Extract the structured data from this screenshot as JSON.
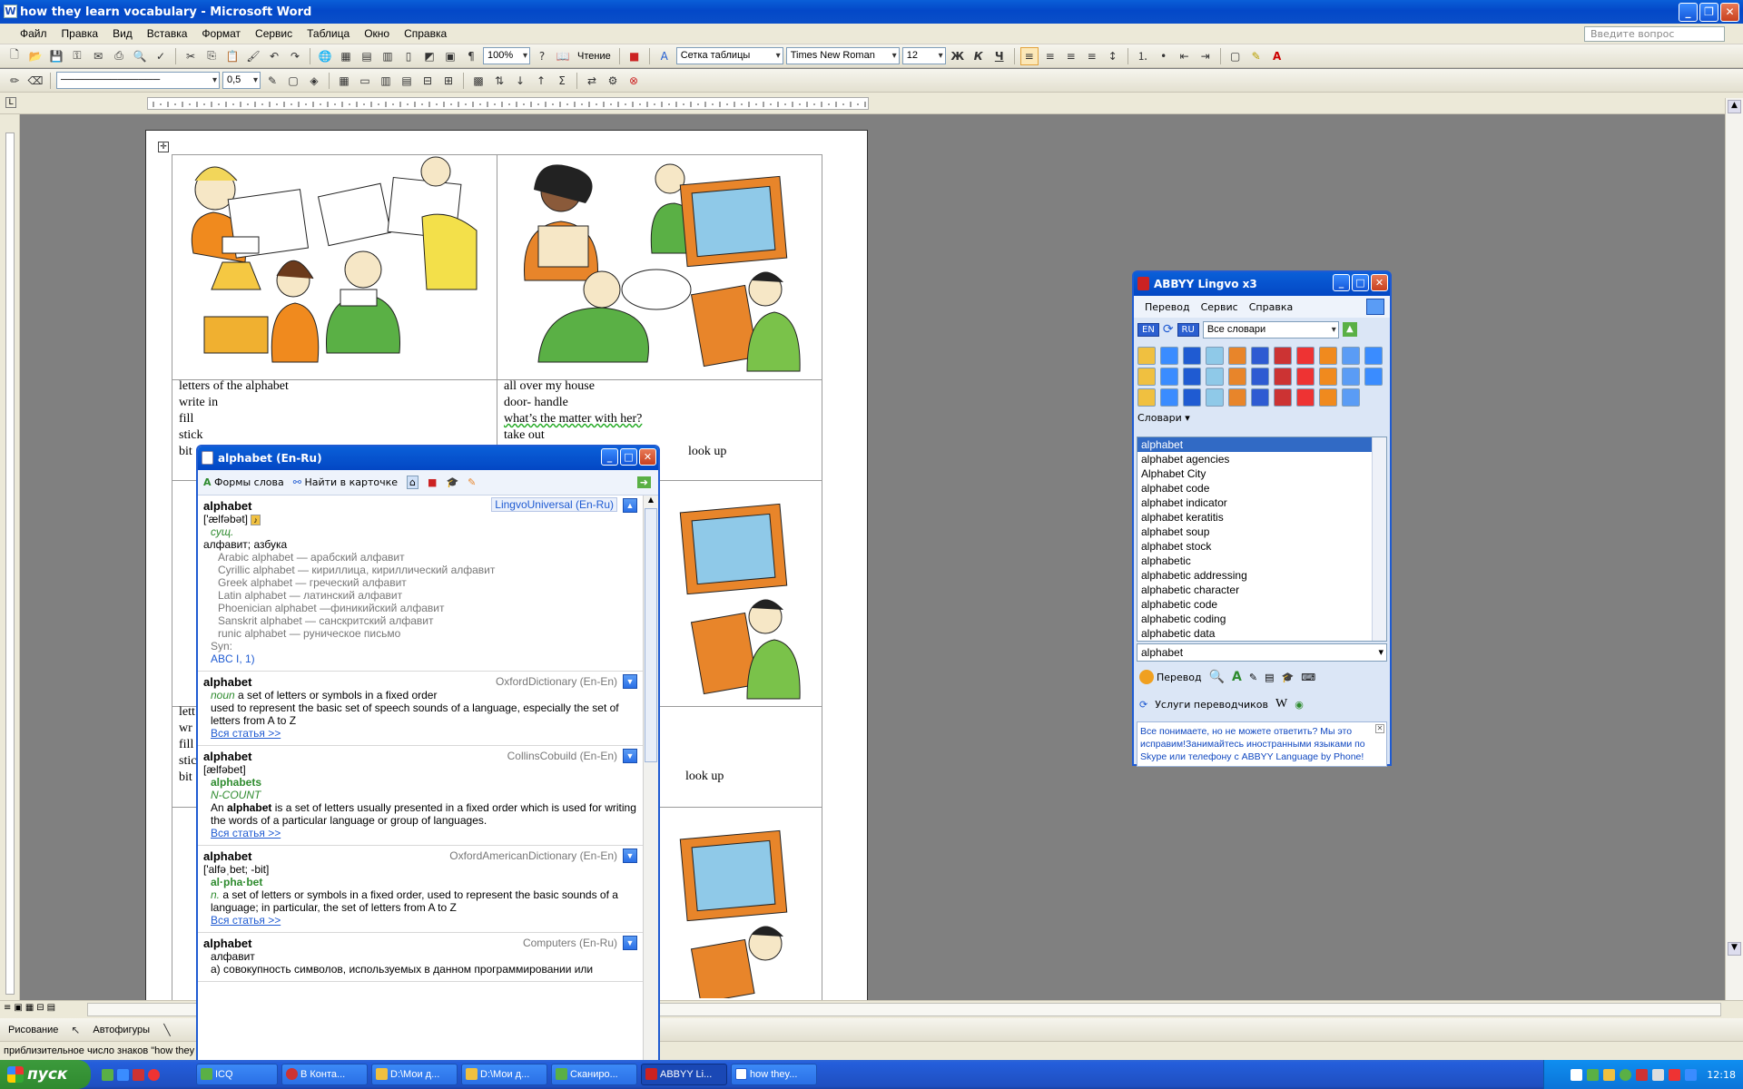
{
  "window": {
    "title": "how they learn vocabulary - Microsoft Word",
    "ask_placeholder": "Введите вопрос"
  },
  "menu": [
    "Файл",
    "Правка",
    "Вид",
    "Вставка",
    "Формат",
    "Сервис",
    "Таблица",
    "Окно",
    "Справка"
  ],
  "toolbar": {
    "zoom": "100%",
    "read_label": "Чтение",
    "table_style": "Сетка таблицы",
    "font": "Times New Roman",
    "size": "12",
    "bold": "Ж",
    "italic": "К",
    "underline": "Ч",
    "line_width": "0,5"
  },
  "document": {
    "cell_left_lines": [
      "letters of the alphabet",
      "write in",
      "fill",
      "stick",
      "bit"
    ],
    "cell_right_lines": [
      "all over my house",
      "door- handle",
      "what’s the matter with her?",
      "take out"
    ],
    "look_up_1": "look up",
    "look_up_2": "look up",
    "cell_left2_lines": [
      "lett",
      "wr",
      "fill",
      "stic",
      "bit"
    ]
  },
  "lingvo": {
    "title": "ABBYY Lingvo x3",
    "menu": [
      "Перевод",
      "Сервис",
      "Справка"
    ],
    "src_lang": "EN",
    "dst_lang": "RU",
    "dict_select": "Все словари",
    "dicts_label": "Словари",
    "words": [
      "alphabet",
      "alphabet agencies",
      "Alphabet City",
      "alphabet code",
      "alphabet indicator",
      "alphabet keratitis",
      "alphabet soup",
      "alphabet stock",
      "alphabetic",
      "alphabetic addressing",
      "alphabetic character",
      "alphabetic code",
      "alphabetic coding",
      "alphabetic data"
    ],
    "search_value": "alphabet",
    "translate_label": "Перевод",
    "services_label": "Услуги переводчиков",
    "promo": "Все понимаете, но не можете ответить? Мы это исправим!Занимайтесь иностранными языками по Skype или телефону с ABBYY Language by Phone!"
  },
  "article": {
    "title": "alphabet (En-Ru)",
    "forms_label": "Формы слова",
    "find_label": "Найти в карточке",
    "e1": {
      "hw": "alphabet",
      "dict": "LingvoUniversal (En-Ru)",
      "tr": "['ælfəbət]",
      "pos": "сущ.",
      "meaning": "алфавит; азбука",
      "examples": [
        "Arabic alphabet — арабский алфавит",
        "Cyrillic alphabet — кириллица, кириллический алфавит",
        "Greek alphabet — греческий алфавит",
        "Latin alphabet — латинский алфавит",
        "Phoenician alphabet —финикийский алфавит",
        "Sanskrit alphabet — санскритский алфавит",
        "runic alphabet — руническое письмо"
      ],
      "syn": "Syn:",
      "syn_val": "ABC I, 1)"
    },
    "e2": {
      "hw": "alphabet",
      "dict": "OxfordDictionary (En-En)",
      "pos": "noun",
      "def": "a set of letters or symbols in a fixed order",
      "def2": "used to represent the basic set of speech sounds of a language, especially the set of letters from A to Z",
      "more": "Вся статья >>"
    },
    "e3": {
      "hw": "alphabet",
      "dict": "CollinsCobuild (En-En)",
      "tr": "[ælfəbet]",
      "form": "alphabets",
      "gram": "N-COUNT",
      "def_pre": "An ",
      "def_bold": "alphabet",
      "def_post": " is a set of letters usually presented in a fixed order which is used for writing the words of a particular language or group of languages.",
      "more": "Вся статья >>"
    },
    "e4": {
      "hw": "alphabet",
      "dict": "OxfordAmericanDictionary (En-En)",
      "tr": "['alfəˌbet; -bit]",
      "syll": "al·pha·bet",
      "pos": "n.",
      "def": "a set of letters or symbols in a fixed order, used to represent the basic sounds of a language; in particular, the set of letters from A to Z",
      "more": "Вся статья >>"
    },
    "e5": {
      "hw": "alphabet",
      "dict": "Computers (En-Ru)",
      "meaning": "алфавит",
      "def": "а) совокупность символов, используемых в данном программировании или"
    }
  },
  "drawing": {
    "draw_label": "Рисование",
    "autoshapes_label": "Автофигуры"
  },
  "status": {
    "text": "приблизительное число знаков \"how they"
  },
  "taskbar": {
    "start": "пуск",
    "tasks": [
      "ICQ",
      "В Конта...",
      "D:\\Мои д...",
      "D:\\Мои д...",
      "Сканиро...",
      "ABBYY Li...",
      "how they..."
    ],
    "clock": "12:18"
  }
}
